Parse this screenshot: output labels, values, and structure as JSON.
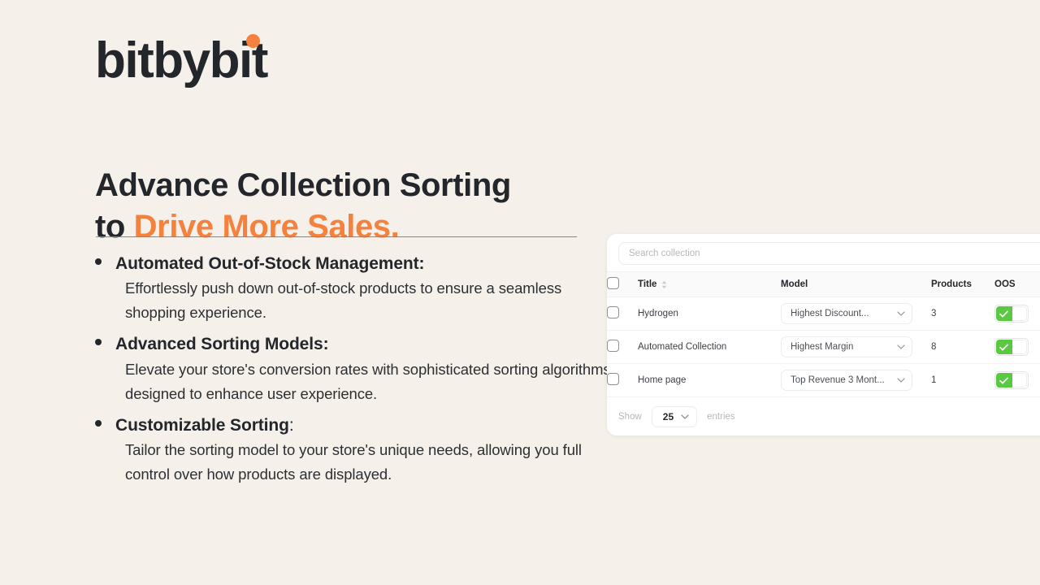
{
  "brand": {
    "logo_part1": "bit",
    "logo_part2": "by",
    "logo_part3": "bit",
    "accent_color": "#f4813d",
    "text_color": "#23262a"
  },
  "headline": {
    "line1": "Advance Collection Sorting",
    "line2_prefix": "to ",
    "line2_accent": "Drive More Sales."
  },
  "bullets": [
    {
      "title": "Automated Out-of-Stock Management:",
      "title_tail": "",
      "body": "Effortlessly push down out-of-stock products to ensure a seamless shopping experience."
    },
    {
      "title": "Advanced Sorting Models:",
      "title_tail": "",
      "body": "Elevate your store's conversion rates with sophisticated sorting algorithms designed to enhance user experience."
    },
    {
      "title": "Customizable Sorting",
      "title_tail": ":",
      "body": "Tailor the sorting model to your store's unique needs, allowing you full control over how products are displayed."
    }
  ],
  "app": {
    "search": {
      "placeholder": "Search collection",
      "value": ""
    },
    "table": {
      "headers": {
        "title": "Title",
        "model": "Model",
        "products": "Products",
        "oos": "OOS"
      },
      "rows": [
        {
          "title": "Hydrogen",
          "model": "Highest Discount...",
          "products": "3",
          "oos_on": true
        },
        {
          "title": "Automated Collection",
          "model": "Highest Margin",
          "products": "8",
          "oos_on": true
        },
        {
          "title": "Home page",
          "model": "Top Revenue 3 Mont...",
          "products": "1",
          "oos_on": true
        }
      ]
    },
    "footer": {
      "show_label": "Show",
      "entries_value": "25",
      "entries_label": "entries"
    },
    "toggle_on_color": "#5ac942"
  }
}
